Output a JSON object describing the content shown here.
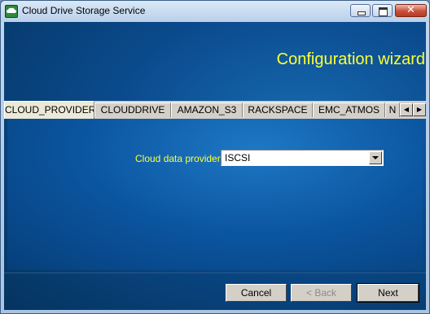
{
  "window": {
    "title": "Cloud Drive Storage Service"
  },
  "header": {
    "title": "Configuration wizard"
  },
  "tabs": [
    {
      "label": "CLOUD_PROVIDER",
      "active": true
    },
    {
      "label": "CLOUDDRIVE"
    },
    {
      "label": "AMAZON_S3"
    },
    {
      "label": "RACKSPACE"
    },
    {
      "label": "EMC_ATMOS"
    },
    {
      "label": "N"
    }
  ],
  "form": {
    "provider_label": "Cloud data provider",
    "provider_value": "ISCSI"
  },
  "buttons": {
    "cancel": "Cancel",
    "back": "< Back",
    "next": "Next"
  },
  "colors": {
    "accent_text": "#ffff33",
    "background": "#0a4a8c"
  }
}
